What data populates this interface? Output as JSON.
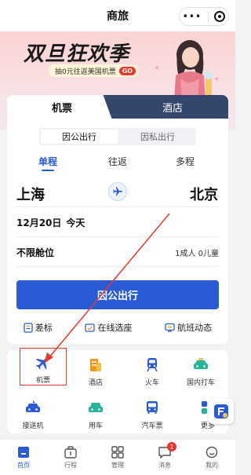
{
  "topbar": {
    "title": "商旅"
  },
  "banner": {
    "headline": "双旦狂欢季",
    "subline": "抽0元往返美国机票",
    "go": "GO"
  },
  "tabs": {
    "flight": "机票",
    "hotel": "酒店"
  },
  "purpose": {
    "business": "因公出行",
    "private": "因私出行"
  },
  "trip_types": [
    "单程",
    "往返",
    "多程"
  ],
  "route": {
    "from": "上海",
    "to": "北京"
  },
  "date": {
    "day": "12月20日",
    "label": "今天"
  },
  "cabin": {
    "class": "不限舱位",
    "passengers": "1成人  0儿童"
  },
  "search_button": "因公出行",
  "tools": {
    "policy": "差标",
    "seat": "在线选座",
    "flight_status": "航班动态"
  },
  "services": [
    {
      "label": "机票",
      "icon": "plane-icon"
    },
    {
      "label": "酒店",
      "icon": "building-icon"
    },
    {
      "label": "火车",
      "icon": "train-icon"
    },
    {
      "label": "国内打车",
      "icon": "taxi-icon"
    },
    {
      "label": "接送机",
      "icon": "shuttle-icon"
    },
    {
      "label": "用车",
      "icon": "car-icon"
    },
    {
      "label": "汽车票",
      "icon": "bus-icon"
    },
    {
      "label": "更多",
      "icon": "grid-icon"
    }
  ],
  "nav": [
    {
      "label": "首页",
      "icon": "home-icon"
    },
    {
      "label": "行程",
      "icon": "suitcase-icon"
    },
    {
      "label": "管理",
      "icon": "apps-icon"
    },
    {
      "label": "消息",
      "icon": "message-icon",
      "badge": "1"
    },
    {
      "label": "我的",
      "icon": "profile-icon"
    }
  ],
  "colors": {
    "accent": "#2a5bd7",
    "tab_dark": "#34466b",
    "highlight": "#e23b2e"
  }
}
